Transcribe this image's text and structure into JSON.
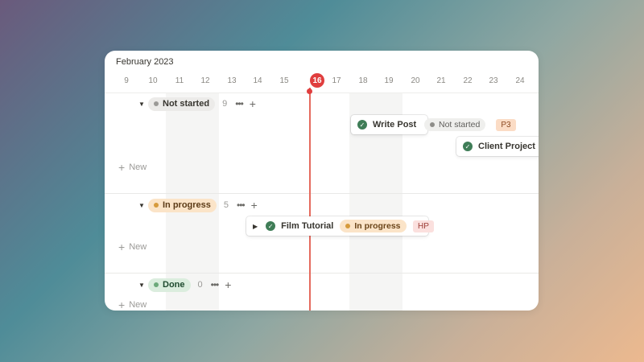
{
  "timeline": {
    "month": "February 2023",
    "days": [
      "9",
      "10",
      "11",
      "12",
      "13",
      "14",
      "15",
      "16",
      "17",
      "18",
      "19",
      "20",
      "21",
      "22",
      "23",
      "24"
    ],
    "today": "16"
  },
  "groups": [
    {
      "label": "Not started",
      "count": "9",
      "color": "gray",
      "more": "•••",
      "add": "+"
    },
    {
      "label": "In progress",
      "count": "5",
      "color": "orange",
      "more": "•••",
      "add": "+"
    },
    {
      "label": "Done",
      "count": "0",
      "color": "green",
      "more": "•••",
      "add": "+"
    }
  ],
  "new_label": "New",
  "tasks": {
    "write_post": {
      "title": "Write Post",
      "status": "Not started",
      "priority": "P3"
    },
    "client_project": {
      "title": "Client Project"
    },
    "film_tutorial": {
      "title": "Film Tutorial",
      "status": "In progress",
      "priority": "HP"
    }
  },
  "icons": {
    "done_check": "check-circle-icon",
    "caret": "triangle-down-icon",
    "expand": "triangle-right-icon",
    "add": "plus-icon",
    "more": "ellipsis-icon"
  },
  "colors": {
    "today": "#e03e3e",
    "check": "#3f7d57",
    "p3_bg": "#fbdcc5",
    "hp_bg": "#fbe0de"
  }
}
